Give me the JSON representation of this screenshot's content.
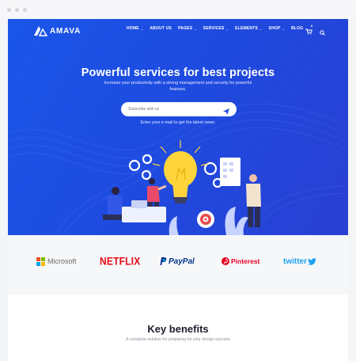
{
  "site": {
    "logo_text": "AMAVA"
  },
  "nav": {
    "items": [
      {
        "label": "HOME",
        "has_dropdown": true
      },
      {
        "label": "ABOUT US",
        "has_dropdown": false
      },
      {
        "label": "PAGES",
        "has_dropdown": true
      },
      {
        "label": "SERVICES",
        "has_dropdown": true
      },
      {
        "label": "ELEMENTS",
        "has_dropdown": true
      },
      {
        "label": "SHOP",
        "has_dropdown": true
      },
      {
        "label": "BLOG",
        "has_dropdown": true
      }
    ],
    "cart_count": "0",
    "icons": [
      "cart-icon",
      "search-icon"
    ]
  },
  "hero": {
    "title": "Powerful services for best projects",
    "subtitle": "Increase your productivity with a strong management and security for powerful features.",
    "subscribe_placeholder": "Subscribe with us",
    "note": "Enter your e-mail to get the latest news."
  },
  "partners": {
    "logos": [
      "Microsoft",
      "NETFLIX",
      "PayPal",
      "Pinterest",
      "twitter"
    ]
  },
  "benefits": {
    "title": "Key benefits",
    "subtitle": "A complete solution for preparing for your design success"
  },
  "colors": {
    "hero_blue": "#1e4be0",
    "netflix_red": "#e50914",
    "paypal_blue": "#003087",
    "pinterest_red": "#e60023",
    "twitter_blue": "#1da1f2",
    "bulb_yellow": "#ffd43b"
  }
}
